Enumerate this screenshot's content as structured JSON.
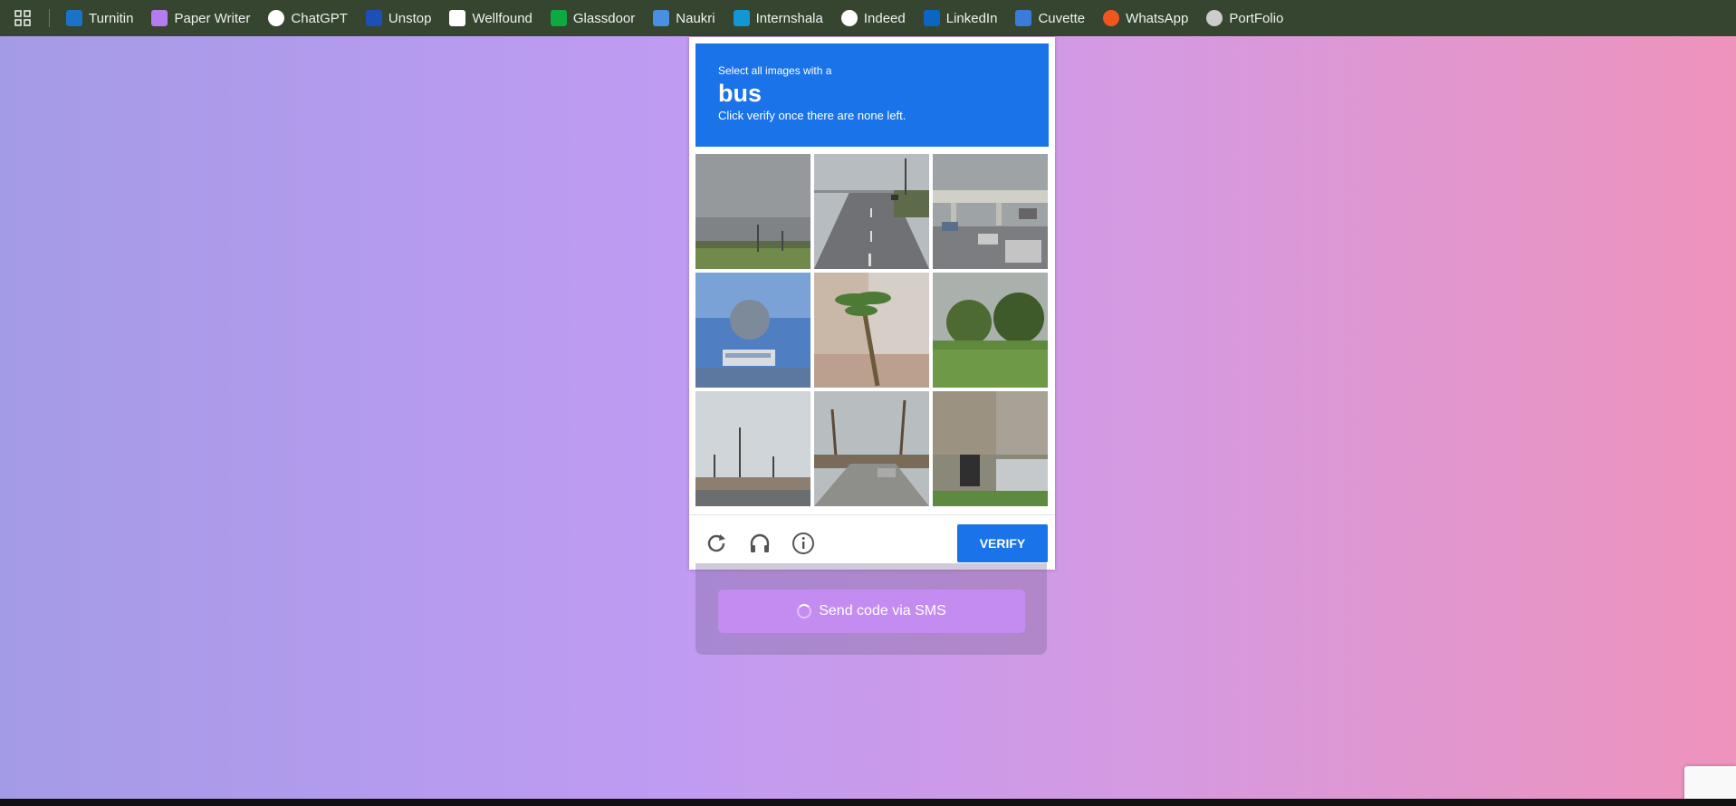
{
  "bookmarks": [
    {
      "label": "Turnitin",
      "icon": "turnitin-icon",
      "color": "#1a73c8"
    },
    {
      "label": "Paper Writer",
      "icon": "paper-writer-icon",
      "color": "#b57cf2"
    },
    {
      "label": "ChatGPT",
      "icon": "chatgpt-icon",
      "color": "#ffffff"
    },
    {
      "label": "Unstop",
      "icon": "unstop-icon",
      "color": "#1c4fb8"
    },
    {
      "label": "Wellfound",
      "icon": "wellfound-icon",
      "color": "#ffffff"
    },
    {
      "label": "Glassdoor",
      "icon": "glassdoor-icon",
      "color": "#0caa41"
    },
    {
      "label": "Naukri",
      "icon": "naukri-icon",
      "color": "#4a90e2"
    },
    {
      "label": "Internshala",
      "icon": "internshala-icon",
      "color": "#1296d4"
    },
    {
      "label": "Indeed",
      "icon": "indeed-icon",
      "color": "#ffffff"
    },
    {
      "label": "LinkedIn",
      "icon": "linkedin-icon",
      "color": "#0a66c2"
    },
    {
      "label": "Cuvette",
      "icon": "cuvette-icon",
      "color": "#3b7bd9"
    },
    {
      "label": "WhatsApp",
      "icon": "whatsapp-icon",
      "color": "#f0561e"
    },
    {
      "label": "PortFolio",
      "icon": "globe-icon",
      "color": "#cccccc"
    }
  ],
  "captcha": {
    "instruction": "Select all images with a",
    "target": "bus",
    "hint": "Click verify once there are none left.",
    "verify_label": "VERIFY"
  },
  "sms_button_label": "Send code via SMS",
  "colors": {
    "accent": "#1a73e8",
    "bookmark_bar": "#35452f",
    "sms_button": "#c48cf0"
  }
}
